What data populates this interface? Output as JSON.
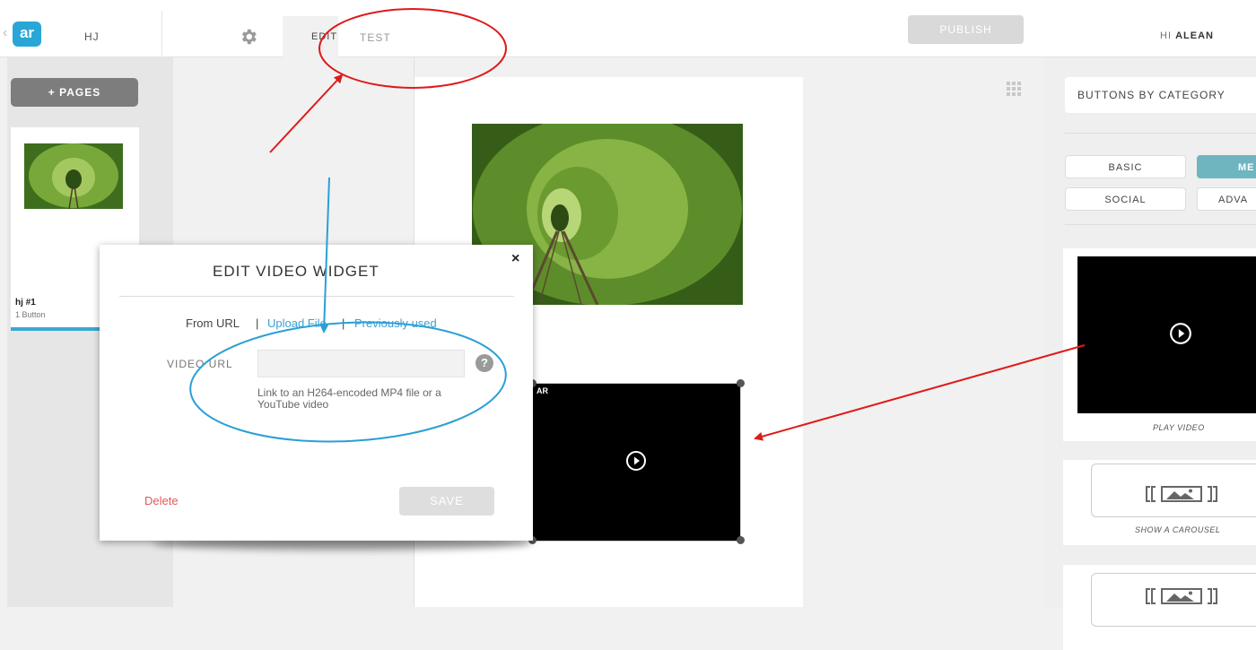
{
  "header": {
    "logo_text": "ar",
    "project_name": "HJ",
    "tabs": [
      {
        "label": "EDIT",
        "active": true
      },
      {
        "label": "TEST",
        "active": false
      }
    ],
    "publish_label": "PUBLISH",
    "greeting_prefix": "HI ",
    "user_name": "ALEAN"
  },
  "pages_panel": {
    "add_pages_label": "+ PAGES",
    "pages": [
      {
        "name": "hj #1",
        "subtitle": "1 Button"
      }
    ]
  },
  "canvas": {
    "video_badge": "AR"
  },
  "modal": {
    "title": "EDIT VIDEO WIDGET",
    "close_label": "×",
    "source_tabs": [
      "From URL",
      "Upload File",
      "Previously used"
    ],
    "separator": "|",
    "url_label": "VIDEO URL",
    "url_value": "",
    "help_label": "?",
    "hint": "Link to an H264-encoded MP4 file or a YouTube video",
    "delete_label": "Delete",
    "save_label": "SAVE"
  },
  "right_panel": {
    "category_select": "BUTTONS BY CATEGORY",
    "categories": [
      {
        "label": "BASIC",
        "active": false
      },
      {
        "label": "ME",
        "active": true
      },
      {
        "label": "SOCIAL",
        "active": false
      },
      {
        "label": "ADVA",
        "active": false
      }
    ],
    "widgets": [
      {
        "label": "PLAY VIDEO",
        "icon": "play-icon"
      },
      {
        "label": "SHOW A CAROUSEL",
        "icon": "carousel-icon"
      },
      {
        "label": "",
        "icon": "carousel-icon"
      }
    ]
  },
  "colors": {
    "accent_blue": "#2aa6d6",
    "link_blue": "#3aa1d4",
    "delete_red": "#e1595b",
    "category_active": "#6fb5c0",
    "annotation_red": "#e01a1a",
    "annotation_blue": "#2a9fd6"
  }
}
